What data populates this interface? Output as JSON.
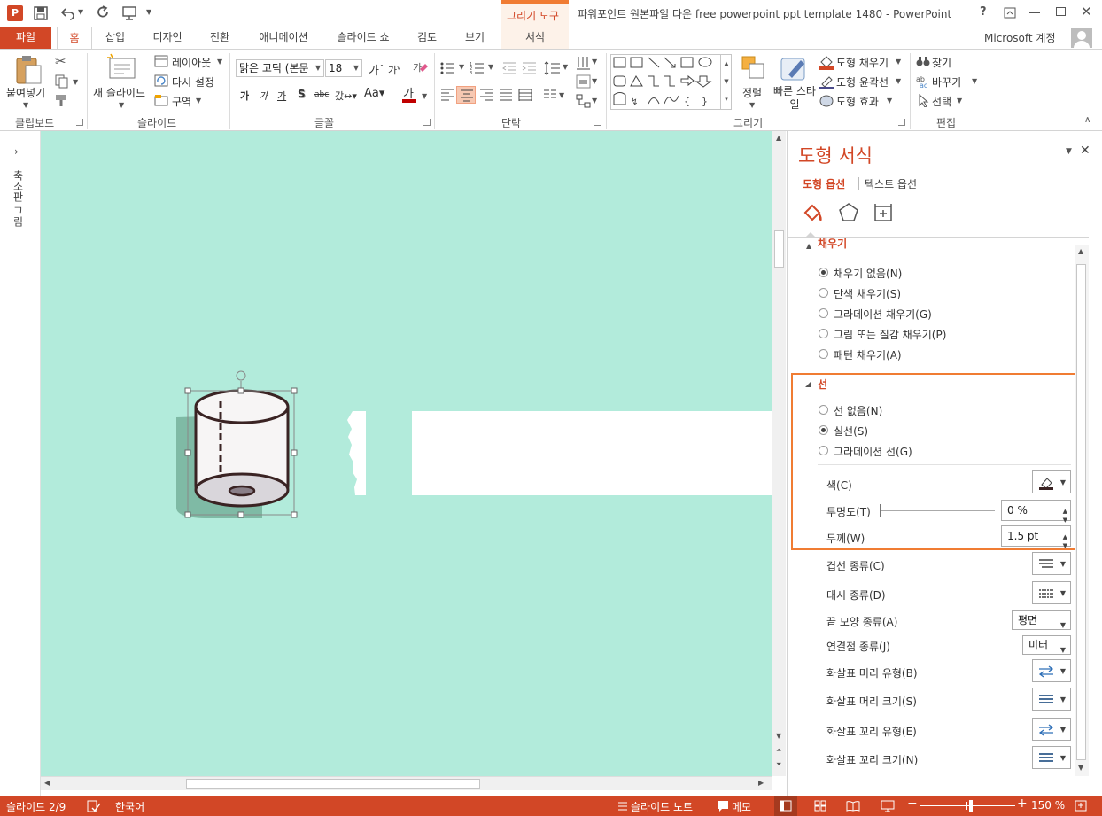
{
  "titlebar": {
    "title": "파워포인트 원본파일 다운 free powerpoint ppt template 1480 - PowerPoint",
    "context_group": "그리기 도구",
    "help": "?",
    "account": "Microsoft 계정"
  },
  "tabs": [
    {
      "label": "파일"
    },
    {
      "label": "홈"
    },
    {
      "label": "삽입"
    },
    {
      "label": "디자인"
    },
    {
      "label": "전환"
    },
    {
      "label": "애니메이션"
    },
    {
      "label": "슬라이드 쇼"
    },
    {
      "label": "검토"
    },
    {
      "label": "보기"
    },
    {
      "label": "서식"
    }
  ],
  "ribbon": {
    "clipboard": {
      "paste": "붙여넣기",
      "group": "클립보드"
    },
    "slides": {
      "new_slide": "새 슬라이드",
      "layout": "레이아웃",
      "reset": "다시 설정",
      "section": "구역",
      "group": "슬라이드"
    },
    "font": {
      "font_name": "맑은 고딕 (본문",
      "font_size": "18",
      "group": "글꼴"
    },
    "paragraph": {
      "group": "단락"
    },
    "drawing": {
      "arrange": "정렬",
      "quick_styles": "빠른 스타일",
      "fill": "도형 채우기",
      "outline": "도형 윤곽선",
      "effects": "도형 효과",
      "group": "그리기"
    },
    "editing": {
      "find": "찾기",
      "replace": "바꾸기",
      "select": "선택",
      "group": "편집"
    }
  },
  "left_strip": {
    "label": "축소판 그림"
  },
  "pane": {
    "title": "도형 서식",
    "tab_shape": "도형 옵션",
    "tab_text": "텍스트 옵션",
    "fill_section": "채우기",
    "fill_options": [
      {
        "label": "채우기 없음(N)",
        "selected": true
      },
      {
        "label": "단색 채우기(S)",
        "selected": false
      },
      {
        "label": "그라데이션 채우기(G)",
        "selected": false
      },
      {
        "label": "그림 또는 질감 채우기(P)",
        "selected": false
      },
      {
        "label": "패턴 채우기(A)",
        "selected": false
      }
    ],
    "line_section": "선",
    "line_options": [
      {
        "label": "선 없음(N)",
        "selected": false
      },
      {
        "label": "실선(S)",
        "selected": true
      },
      {
        "label": "그라데이션 선(G)",
        "selected": false
      }
    ],
    "color_label": "색(C)",
    "transparency_label": "투명도(T)",
    "transparency_value": "0 %",
    "width_label": "두께(W)",
    "width_value": "1.5 pt",
    "compound_label": "겹선 종류(C)",
    "dash_label": "대시 종류(D)",
    "cap_label": "끝 모양 종류(A)",
    "cap_value": "평면",
    "join_label": "연결점 종류(J)",
    "join_value": "미터",
    "begin_arrow_type": "화살표 머리 유형(B)",
    "begin_arrow_size": "화살표 머리 크기(S)",
    "end_arrow_type": "화살표 꼬리 유형(E)",
    "end_arrow_size": "화살표 꼬리 크기(N)",
    "colors": {
      "accent": "#d24726",
      "highlight": "#f07c33"
    }
  },
  "statusbar": {
    "slide": "슬라이드 2/9",
    "language": "한국어",
    "notes": "슬라이드 노트",
    "comments": "메모",
    "zoom": "150 %"
  }
}
